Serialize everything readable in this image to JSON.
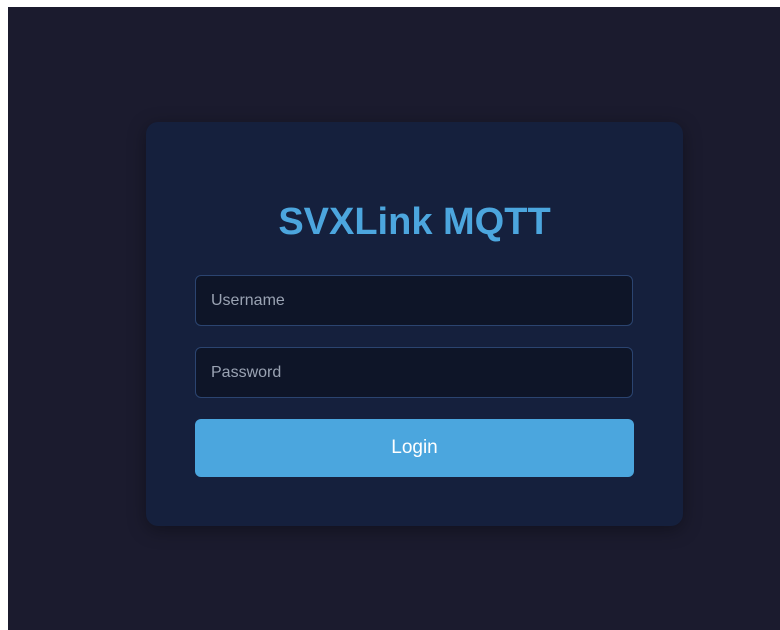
{
  "login_form": {
    "title": "SVXLink MQTT",
    "username": {
      "value": "",
      "placeholder": "Username"
    },
    "password": {
      "value": "",
      "placeholder": "Password"
    },
    "login_label": "Login"
  },
  "colors": {
    "page_background": "#1b1b2e",
    "card_background": "#15203d",
    "accent": "#4ca6de",
    "input_background": "#0e1528",
    "input_border": "#2b4470"
  }
}
